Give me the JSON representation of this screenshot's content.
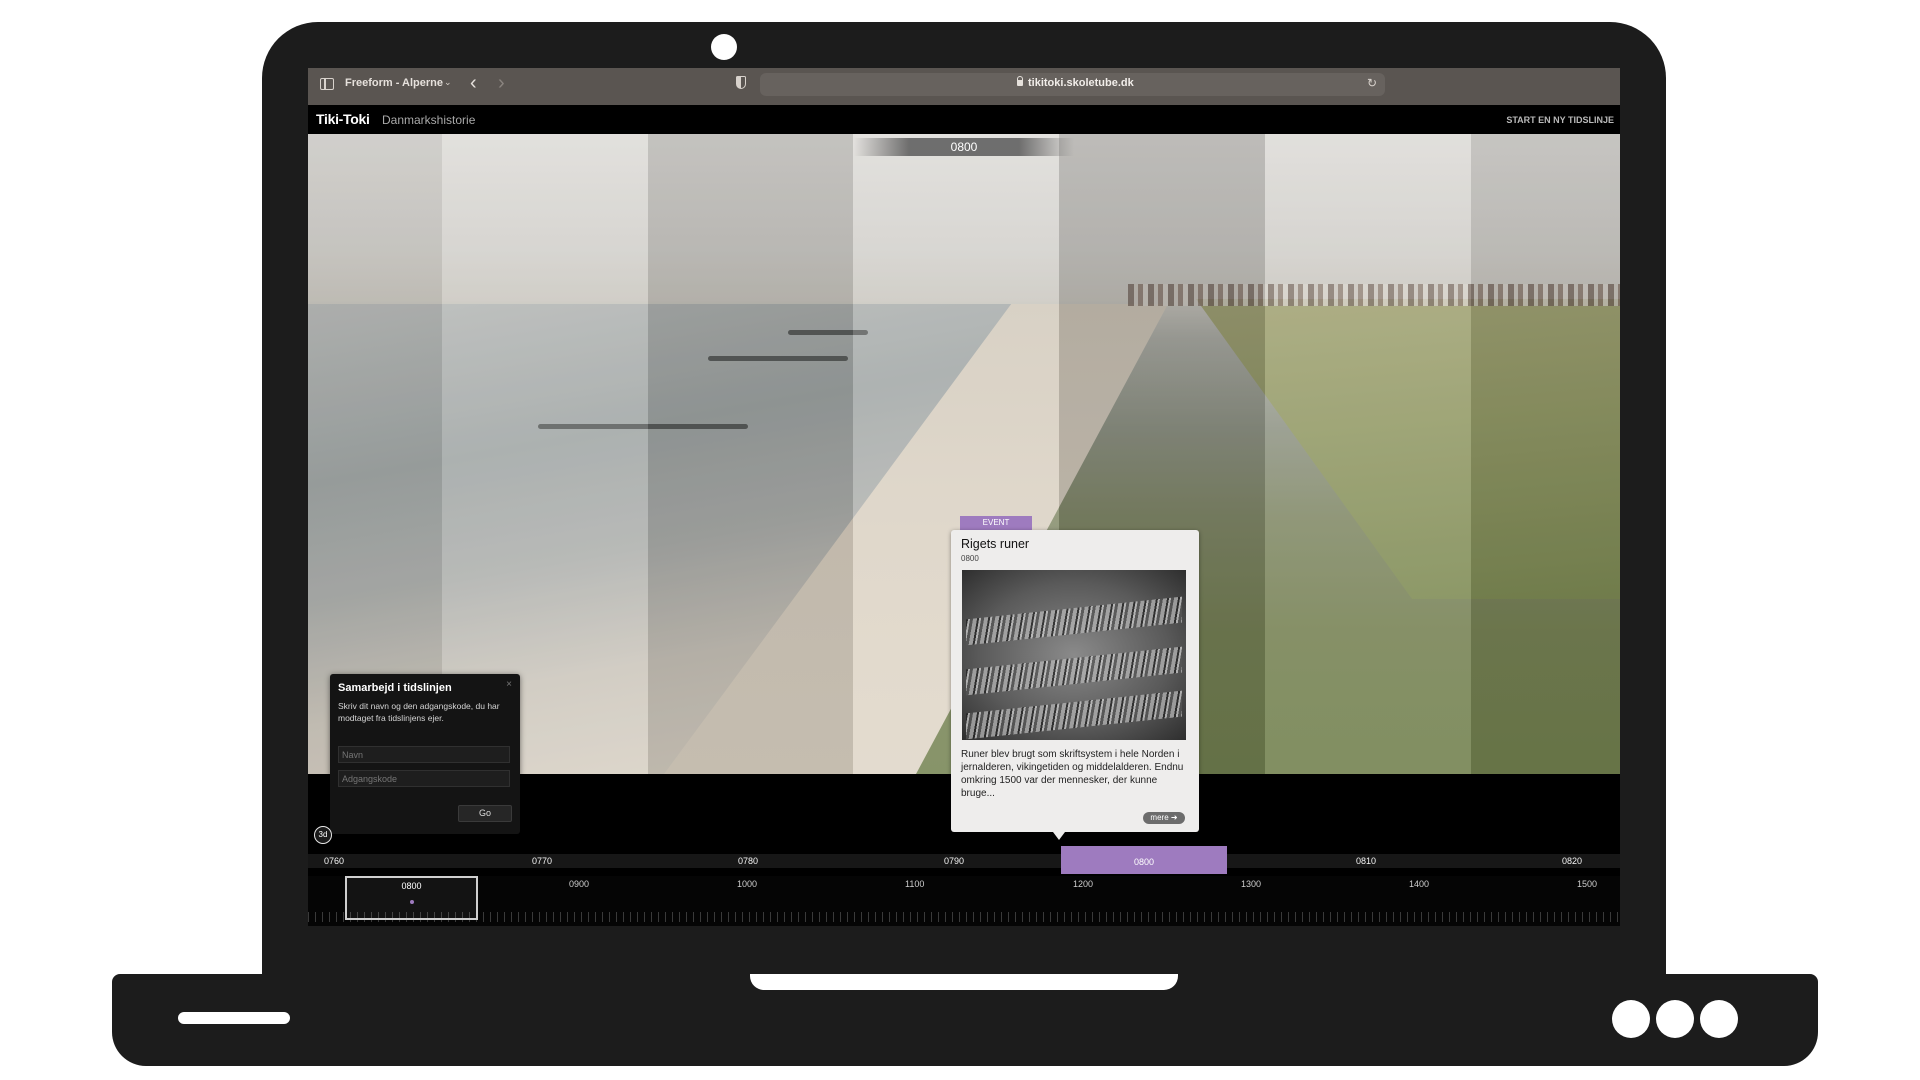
{
  "browser": {
    "tab_group": "Freeform - Alperne",
    "url": "tikitoki.skoletube.dk"
  },
  "app": {
    "logo": "Tiki-Toki",
    "title": "Danmarkshistorie",
    "start_new": "START EN NY TIDSLINJE"
  },
  "timeline": {
    "current_date": "0800",
    "band_labels": [
      "0760",
      "0770",
      "0780",
      "0790",
      "0800",
      "0810",
      "0820"
    ],
    "active_label": "0800",
    "overview_labels": [
      "0900",
      "1000",
      "1100",
      "1200",
      "1300",
      "1400",
      "1500"
    ],
    "overview_window_label": "0800",
    "btn_3d": "3d"
  },
  "event": {
    "tag": "EVENT",
    "title": "Rigets runer",
    "date": "0800",
    "text": "Runer blev brugt som skriftsystem i hele Norden i jernalderen, vikingetiden og middelalderen. Endnu omkring 1500 var der mennesker, der kunne bruge...",
    "more": "mere ➜"
  },
  "collab": {
    "title": "Samarbejd i tidslinjen",
    "close": "×",
    "description": "Skriv dit navn og den adgangskode, du har modtaget fra tidslinjens ejer.",
    "name_placeholder": "Navn",
    "code_placeholder": "Adgangskode",
    "go": "Go"
  },
  "colors": {
    "accent": "#9e7bbf",
    "laptop": "#1c1c1c",
    "toolbar": "#5a5551"
  }
}
